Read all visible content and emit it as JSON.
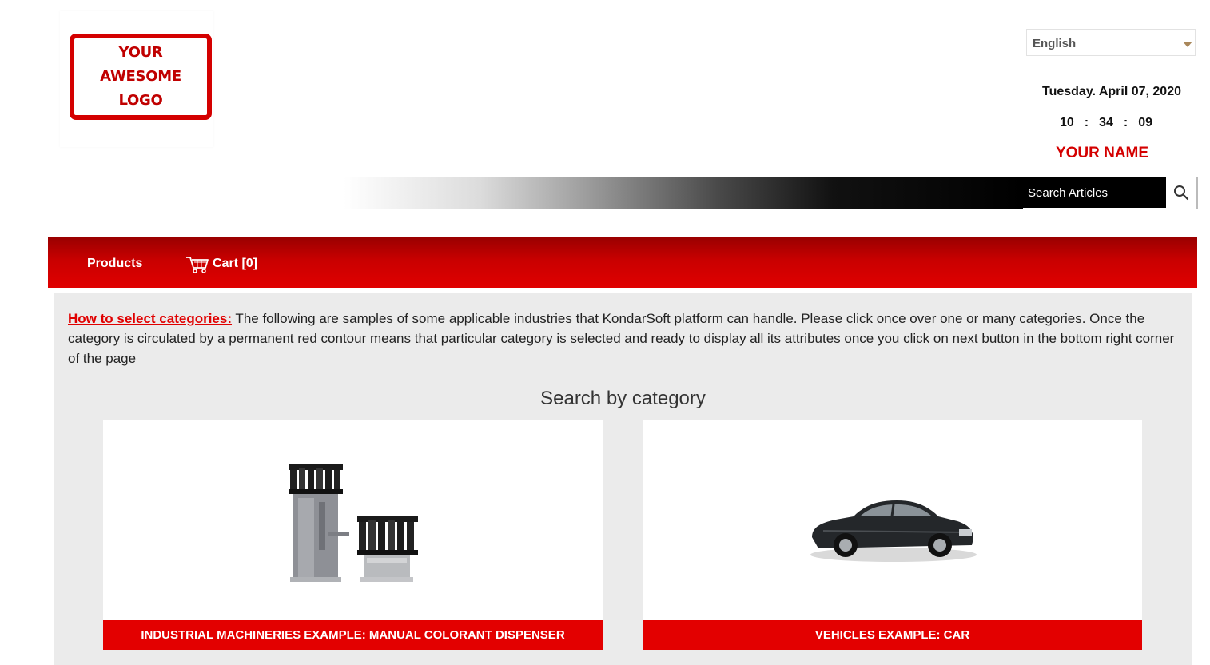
{
  "header": {
    "logo_text": "YOUR AWESOME LOGO",
    "language": {
      "selected": "English"
    },
    "date": "Tuesday. April 07, 2020",
    "time": {
      "hours": "10",
      "minutes": "34",
      "seconds": "09",
      "separator": ":"
    },
    "user_name": "YOUR NAME",
    "search": {
      "placeholder": "Search Articles"
    }
  },
  "nav": {
    "products_label": "Products",
    "cart_label": "Cart [0]"
  },
  "main": {
    "intro_link": "How to select categories:",
    "intro_text": " The following are samples of some applicable industries that KondarSoft platform can handle. Please click once over one or many categories. Once the category is circulated by a permanent red contour means that particular category is selected and ready to display all its attributes once you click on next button in the bottom right corner of the page",
    "section_title": "Search by category",
    "categories": [
      {
        "label": "INDUSTRIAL MACHINERIES EXAMPLE: MANUAL COLORANT DISPENSER",
        "image": "colorant-dispenser-image"
      },
      {
        "label": "VEHICLES EXAMPLE: CAR",
        "image": "car-image"
      }
    ]
  },
  "colors": {
    "brand_red": "#e30000",
    "nav_dark_red": "#9a0000",
    "search_bg": "#000000",
    "content_bg": "#ebebeb"
  }
}
